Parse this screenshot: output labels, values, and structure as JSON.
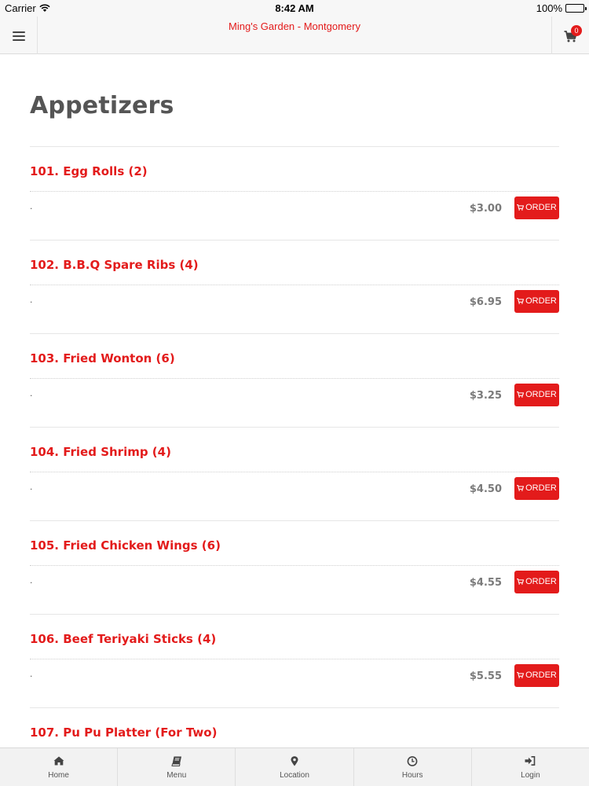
{
  "status_bar": {
    "carrier": "Carrier",
    "time": "8:42 AM",
    "battery": "100%"
  },
  "header": {
    "title": "Ming's Garden - Montgomery",
    "cart_count": "0"
  },
  "section": {
    "title": "Appetizers"
  },
  "menu_items": [
    {
      "name": "101. Egg Rolls (2)",
      "description": ".",
      "price": "$3.00",
      "order_label": "ORDER"
    },
    {
      "name": "102. B.B.Q Spare Ribs (4)",
      "description": ".",
      "price": "$6.95",
      "order_label": "ORDER"
    },
    {
      "name": "103. Fried Wonton (6)",
      "description": ".",
      "price": "$3.25",
      "order_label": "ORDER"
    },
    {
      "name": "104. Fried Shrimp (4)",
      "description": ".",
      "price": "$4.50",
      "order_label": "ORDER"
    },
    {
      "name": "105. Fried Chicken Wings (6)",
      "description": ".",
      "price": "$4.55",
      "order_label": "ORDER"
    },
    {
      "name": "106. Beef Teriyaki Sticks (4)",
      "description": ".",
      "price": "$5.55",
      "order_label": "ORDER"
    },
    {
      "name": "107. Pu Pu Platter (For Two)",
      "description": "",
      "price": "",
      "order_label": ""
    }
  ],
  "tab_bar": [
    {
      "label": "Home",
      "icon": "home-icon"
    },
    {
      "label": "Menu",
      "icon": "book-icon"
    },
    {
      "label": "Location",
      "icon": "map-marker-icon"
    },
    {
      "label": "Hours",
      "icon": "clock-icon"
    },
    {
      "label": "Login",
      "icon": "login-icon"
    }
  ],
  "colors": {
    "accent": "#e31b1b",
    "price": "#7a7a7a",
    "heading": "#555555"
  }
}
